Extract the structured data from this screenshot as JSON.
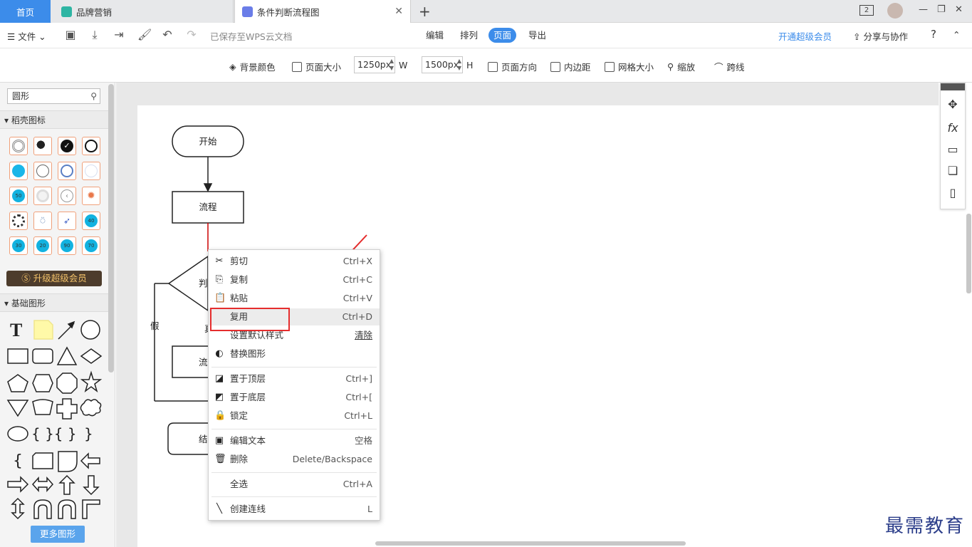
{
  "tabs": {
    "home": "首页",
    "brand": "品牌营销",
    "flow": "条件判断流程图",
    "badge": "2"
  },
  "toolbar1": {
    "file": "文件",
    "saved": "已保存至WPS云文档",
    "menus": [
      "编辑",
      "排列",
      "页面",
      "导出"
    ],
    "vip": "开通超级会员",
    "share": "分享与协作",
    "help": "?"
  },
  "toolbar2": {
    "bg_color": "背景颜色",
    "page_size": "页面大小",
    "width_value": "1250px",
    "width_label": "W",
    "height_value": "1500px",
    "height_label": "H",
    "orientation": "页面方向",
    "padding": "内边距",
    "grid": "网格大小",
    "zoom": "缩放",
    "jump": "跨线"
  },
  "left": {
    "search_value": "圆形",
    "section1": "稻壳图标",
    "icon_labels": [
      "50",
      "40",
      "30",
      "20",
      "90",
      "70"
    ],
    "upgrade": "升级超级会员",
    "section2": "基础图形",
    "more": "更多图形"
  },
  "flow": {
    "start": "开始",
    "process": "流程",
    "decision": "判",
    "no": "假",
    "yes": "真",
    "process2": "流",
    "end": "结"
  },
  "context_menu": {
    "items": [
      {
        "label": "剪切",
        "shortcut": "Ctrl+X",
        "icon": "scissors-icon"
      },
      {
        "label": "复制",
        "shortcut": "Ctrl+C",
        "icon": "copy-icon"
      },
      {
        "label": "粘贴",
        "shortcut": "Ctrl+V",
        "icon": "paste-icon"
      },
      {
        "label": "复用",
        "shortcut": "Ctrl+D",
        "icon": ""
      },
      {
        "label": "设置默认样式",
        "shortcut": "清除",
        "icon": ""
      },
      {
        "label": "替换图形",
        "shortcut": "",
        "icon": "replace-shape-icon"
      },
      {
        "label": "置于顶层",
        "shortcut": "Ctrl+]",
        "icon": "bring-front-icon"
      },
      {
        "label": "置于底层",
        "shortcut": "Ctrl+[",
        "icon": "send-back-icon"
      },
      {
        "label": "锁定",
        "shortcut": "Ctrl+L",
        "icon": "lock-icon"
      },
      {
        "label": "编辑文本",
        "shortcut": "空格",
        "icon": "edit-text-icon"
      },
      {
        "label": "删除",
        "shortcut": "Delete/Backspace",
        "icon": "trash-icon"
      },
      {
        "label": "全选",
        "shortcut": "Ctrl+A",
        "icon": ""
      },
      {
        "label": "创建连线",
        "shortcut": "L",
        "icon": "line-icon"
      }
    ]
  },
  "watermark": "最需教育",
  "colors": {
    "accent": "#3c8cea",
    "highlight": "#e52d2d",
    "upgrade_bg": "#4d3c2c",
    "upgrade_text": "#f3c26a"
  }
}
